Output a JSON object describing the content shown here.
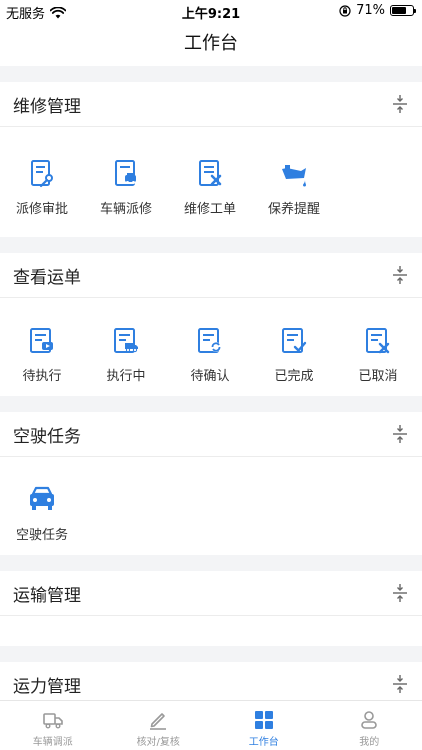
{
  "status_bar": {
    "carrier": "无服务",
    "time": "上午9:21",
    "battery": "71%"
  },
  "nav": {
    "title": "工作台"
  },
  "sections": [
    {
      "title": "维修管理",
      "items": [
        {
          "label": "派修审批",
          "icon": "repair-approve-icon"
        },
        {
          "label": "车辆派修",
          "icon": "vehicle-dispatch-repair-icon"
        },
        {
          "label": "维修工单",
          "icon": "repair-workorder-icon"
        },
        {
          "label": "保养提醒",
          "icon": "maintenance-reminder-icon"
        }
      ]
    },
    {
      "title": "查看运单",
      "items": [
        {
          "label": "待执行",
          "icon": "pending-execute-icon"
        },
        {
          "label": "执行中",
          "icon": "executing-icon"
        },
        {
          "label": "待确认",
          "icon": "pending-confirm-icon"
        },
        {
          "label": "已完成",
          "icon": "completed-icon"
        },
        {
          "label": "已取消",
          "icon": "cancelled-icon"
        }
      ]
    },
    {
      "title": "空驶任务",
      "items": [
        {
          "label": "空驶任务",
          "icon": "empty-run-task-icon"
        }
      ]
    },
    {
      "title": "运输管理",
      "items": []
    },
    {
      "title": "运力管理",
      "items": []
    }
  ],
  "tabs": [
    {
      "label": "车辆调派",
      "icon": "truck-icon",
      "active": false
    },
    {
      "label": "核对/复核",
      "icon": "pen-icon",
      "active": false
    },
    {
      "label": "工作台",
      "icon": "workbench-icon",
      "active": true
    },
    {
      "label": "我的",
      "icon": "user-icon",
      "active": false
    }
  ],
  "colors": {
    "accent": "#2f7fe0",
    "inactive": "#999999"
  }
}
